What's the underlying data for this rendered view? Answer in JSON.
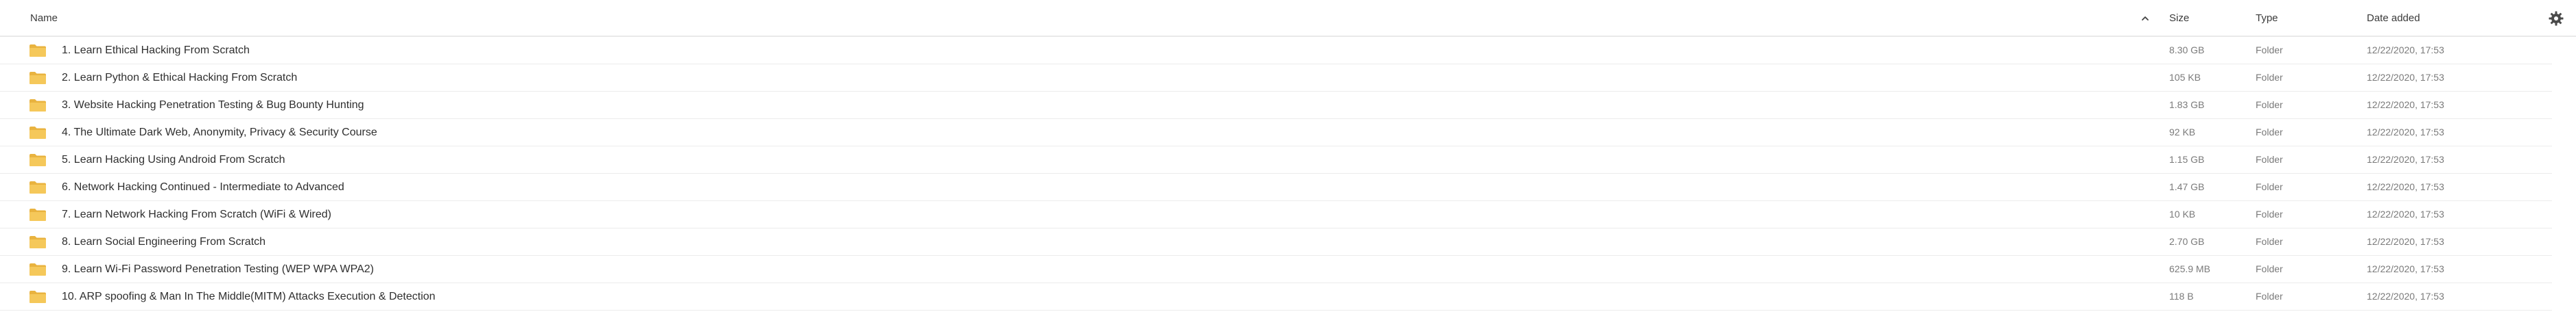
{
  "colors": {
    "folder": "#f5c85a",
    "folder_tab": "#e9b33f",
    "divider": "#ececec",
    "header_text": "#3a3a3a",
    "muted_text": "#7a7a7a"
  },
  "header": {
    "name_label": "Name",
    "size_label": "Size",
    "type_label": "Type",
    "date_label": "Date added",
    "sort_icon": "chevron-up-icon",
    "settings_icon": "gear-icon"
  },
  "files": [
    {
      "name": "1. Learn Ethical Hacking From Scratch",
      "size": "8.30 GB",
      "type": "Folder",
      "date": "12/22/2020, 17:53",
      "icon": "folder-icon"
    },
    {
      "name": "2. Learn Python & Ethical Hacking From Scratch",
      "size": "105 KB",
      "type": "Folder",
      "date": "12/22/2020, 17:53",
      "icon": "folder-icon"
    },
    {
      "name": "3. Website Hacking Penetration Testing & Bug Bounty Hunting",
      "size": "1.83 GB",
      "type": "Folder",
      "date": "12/22/2020, 17:53",
      "icon": "folder-icon"
    },
    {
      "name": "4. The Ultimate Dark Web, Anonymity, Privacy & Security Course",
      "size": "92 KB",
      "type": "Folder",
      "date": "12/22/2020, 17:53",
      "icon": "folder-icon"
    },
    {
      "name": "5. Learn Hacking Using Android From Scratch",
      "size": "1.15 GB",
      "type": "Folder",
      "date": "12/22/2020, 17:53",
      "icon": "folder-icon"
    },
    {
      "name": "6. Network Hacking Continued - Intermediate to Advanced",
      "size": "1.47 GB",
      "type": "Folder",
      "date": "12/22/2020, 17:53",
      "icon": "folder-icon"
    },
    {
      "name": "7. Learn Network Hacking From Scratch (WiFi & Wired)",
      "size": "10 KB",
      "type": "Folder",
      "date": "12/22/2020, 17:53",
      "icon": "folder-icon"
    },
    {
      "name": "8. Learn Social Engineering From Scratch",
      "size": "2.70 GB",
      "type": "Folder",
      "date": "12/22/2020, 17:53",
      "icon": "folder-icon"
    },
    {
      "name": "9. Learn Wi-Fi Password Penetration Testing (WEP WPA WPA2)",
      "size": "625.9 MB",
      "type": "Folder",
      "date": "12/22/2020, 17:53",
      "icon": "folder-icon"
    },
    {
      "name": "10. ARP spoofing & Man In The Middle(MITM) Attacks Execution & Detection",
      "size": "118 B",
      "type": "Folder",
      "date": "12/22/2020, 17:53",
      "icon": "folder-icon"
    }
  ]
}
